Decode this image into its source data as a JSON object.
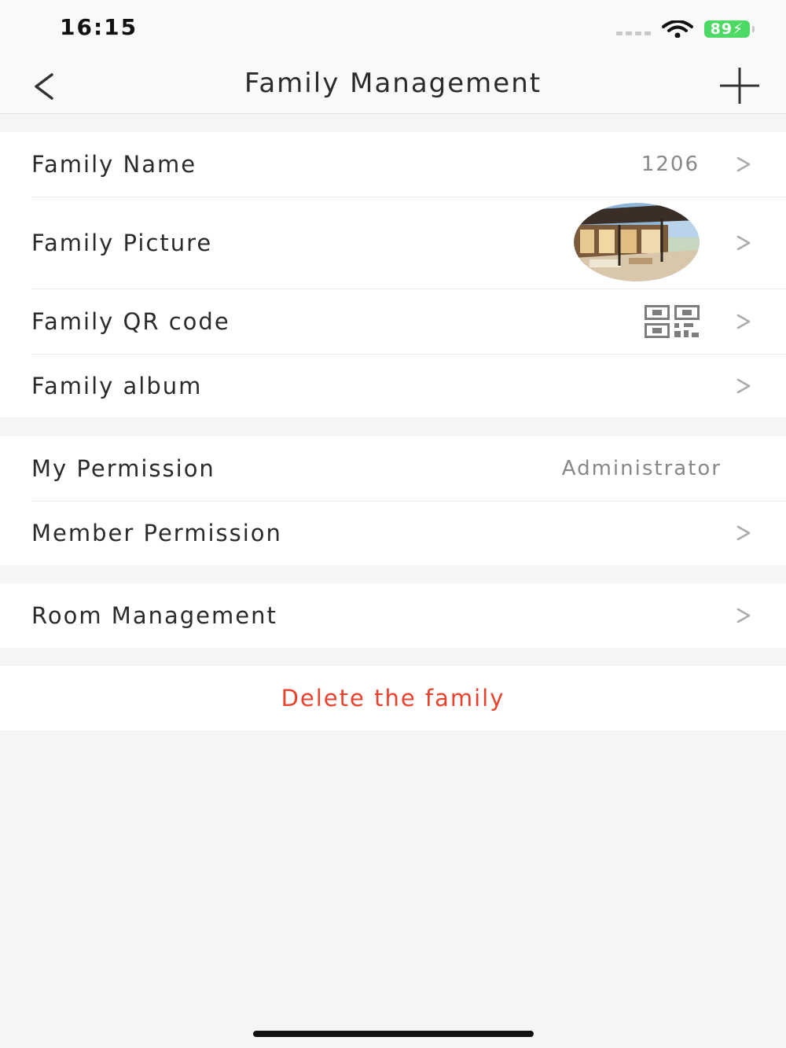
{
  "status": {
    "time": "16:15",
    "battery": "89"
  },
  "nav": {
    "title": "Family Management"
  },
  "family_section": {
    "name_label": "Family Name",
    "name_value": "1206",
    "picture_label": "Family Picture",
    "qr_label": "Family QR code",
    "album_label": "Family album"
  },
  "permission_section": {
    "my_label": "My Permission",
    "my_value": "Administrator",
    "member_label": "Member Permission"
  },
  "room_section": {
    "label": "Room Management"
  },
  "delete": {
    "label": "Delete the family"
  },
  "colors": {
    "accent_danger": "#e8412c",
    "battery": "#4cd964",
    "background": "#f5f5f5"
  },
  "icons": [
    "back-icon",
    "plus-icon",
    "wifi-icon",
    "chevron-right-icon",
    "qr-code-icon"
  ]
}
